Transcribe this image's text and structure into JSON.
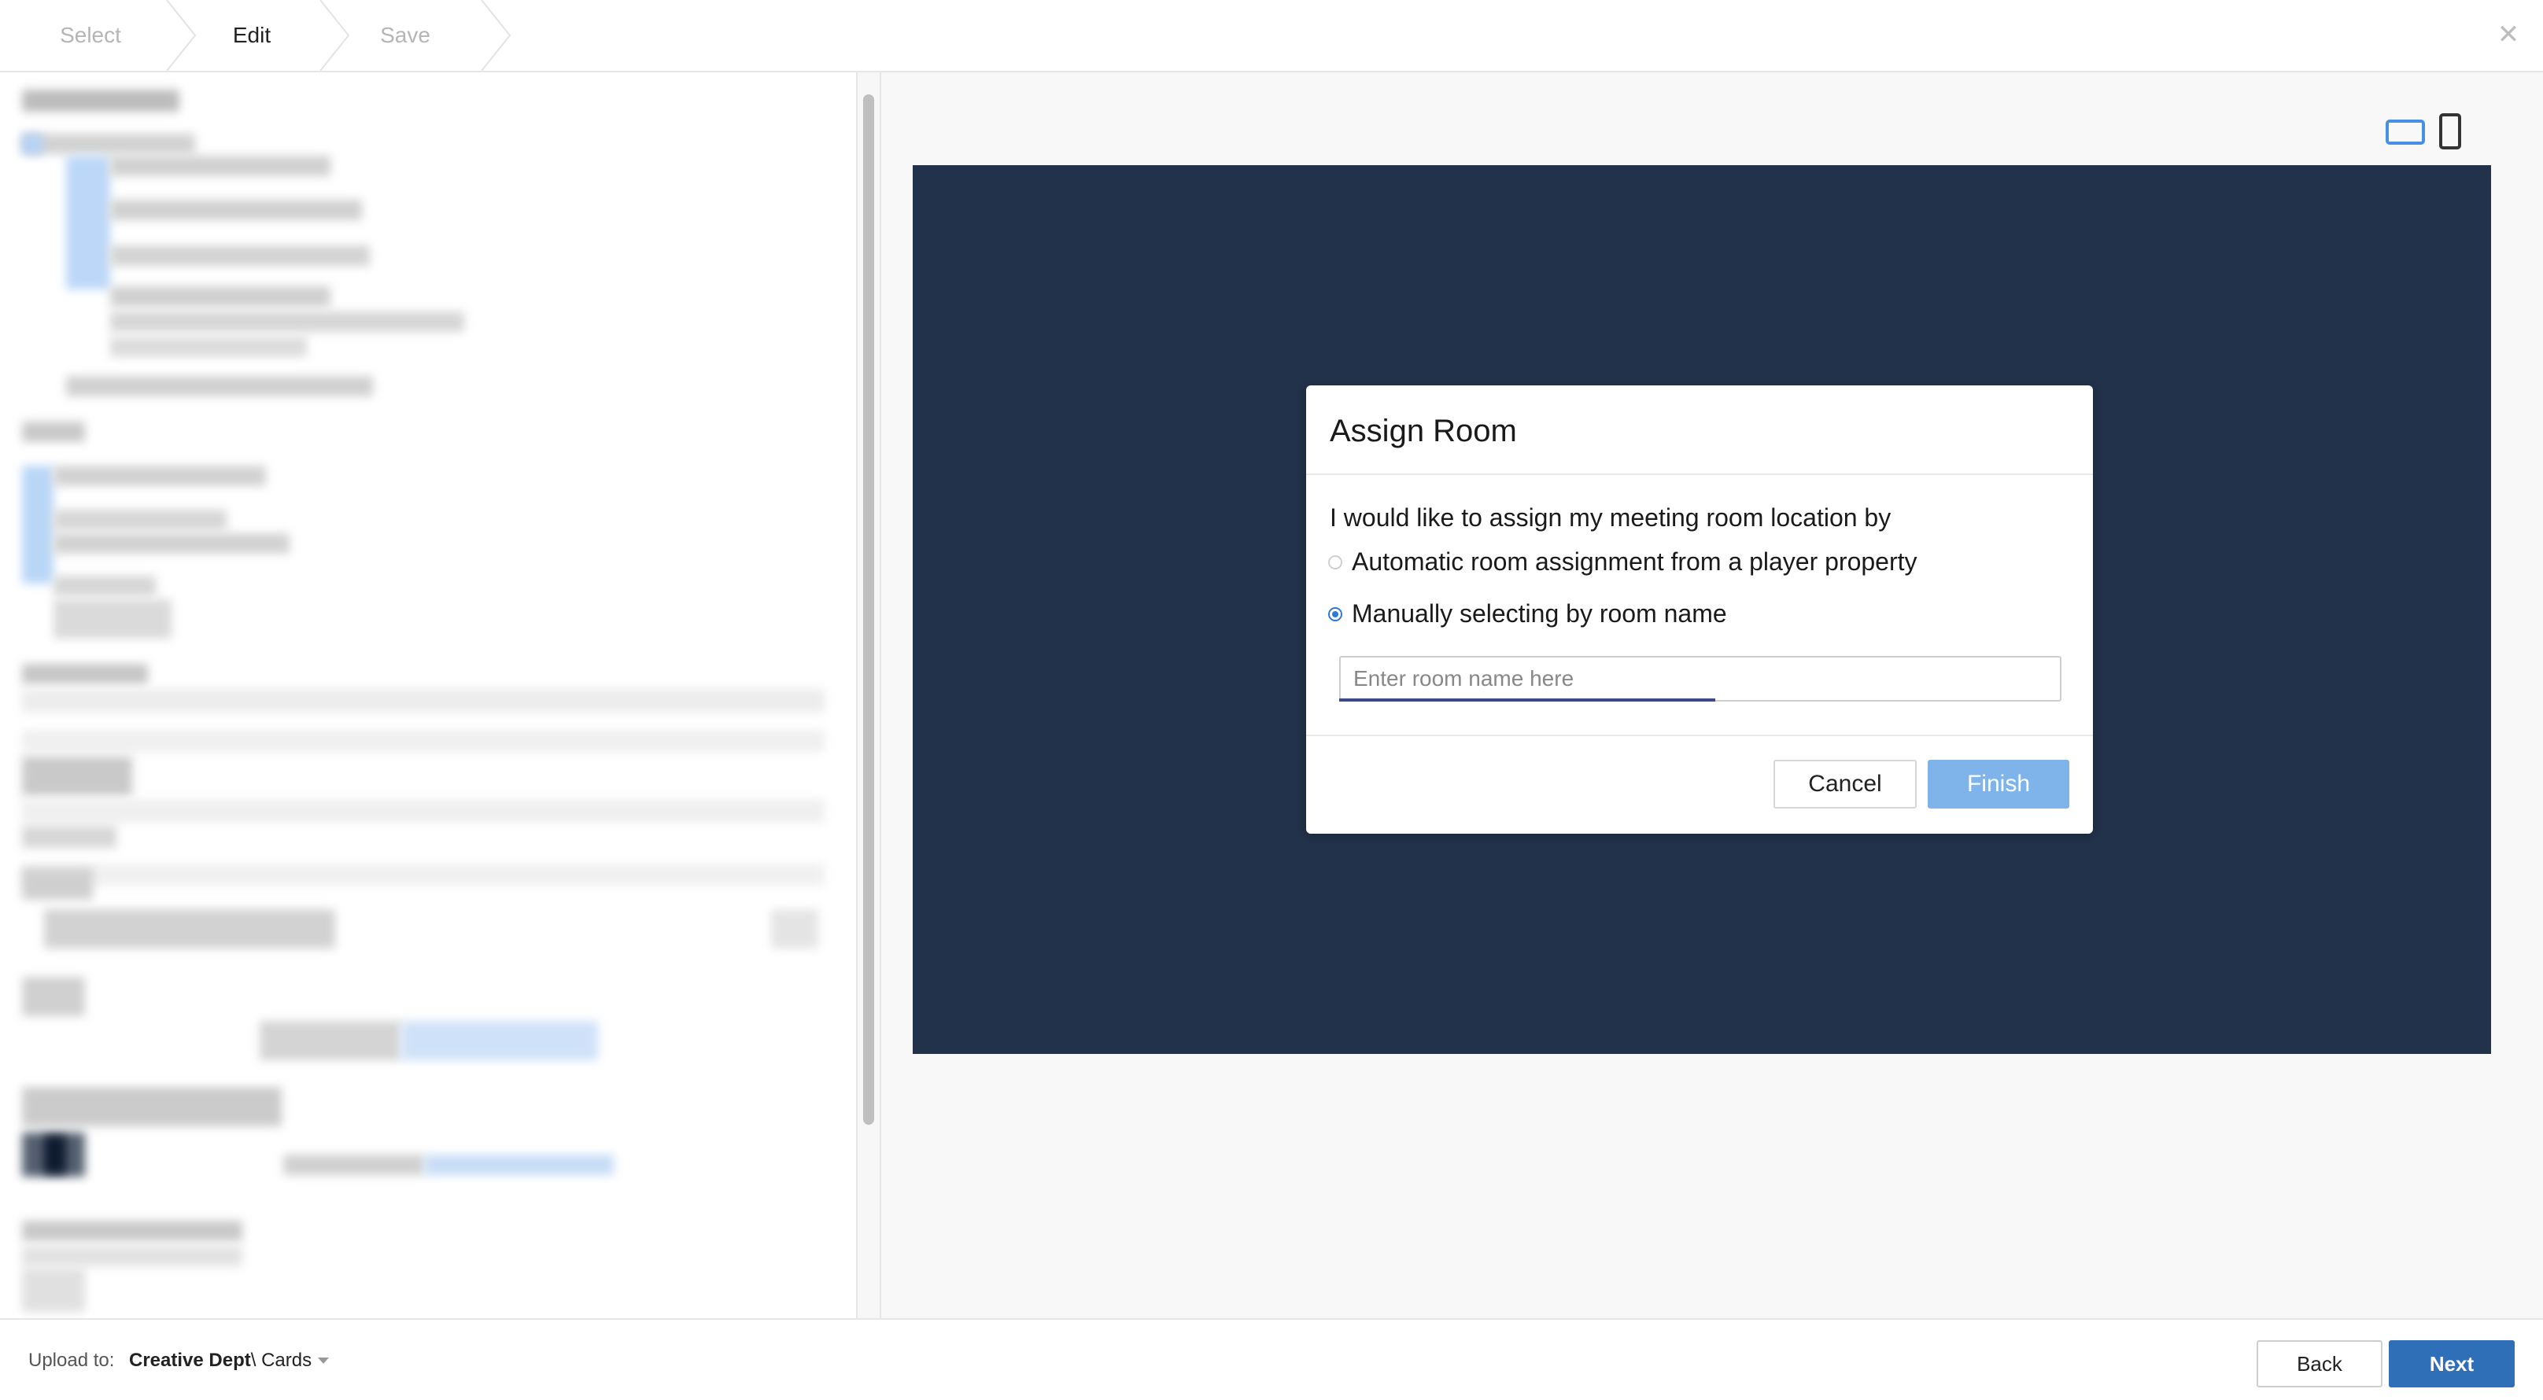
{
  "stepper": {
    "steps": [
      "Select",
      "Edit",
      "Save"
    ],
    "active": "Edit"
  },
  "window": {
    "close_icon": "close-icon"
  },
  "preview": {
    "orientation": {
      "landscape_icon": "landscape-icon",
      "portrait_icon": "portrait-icon",
      "selected": "landscape"
    },
    "canvas_color": "#22324a"
  },
  "dialog": {
    "title": "Assign Room",
    "prompt": "I would like to assign my meeting room location by",
    "options": [
      {
        "label": "Automatic room assignment from a player property",
        "checked": false
      },
      {
        "label": "Manually selecting by room name",
        "checked": true
      }
    ],
    "input": {
      "placeholder": "Enter room name here",
      "value": ""
    },
    "cancel_label": "Cancel",
    "finish_label": "Finish"
  },
  "footer": {
    "upload_label": "Upload to:",
    "folder_bold": "Creative Dept",
    "folder_rest": " \\ Cards",
    "back_label": "Back",
    "next_label": "Next"
  },
  "colors": {
    "accent": "#2d7ad6",
    "next_button": "#2f6fb8",
    "finish_button": "#7fb4ea"
  }
}
